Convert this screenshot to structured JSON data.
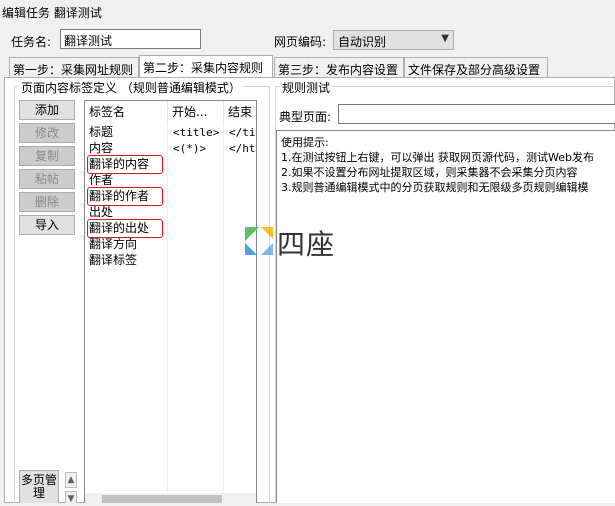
{
  "window": {
    "title": "编辑任务 翻译测试"
  },
  "task": {
    "name_label": "任务名:",
    "name_value": "翻译测试"
  },
  "encoding": {
    "label": "网页编码:",
    "value": "自动识别"
  },
  "tabs": [
    "第一步：采集网址规则",
    "第二步：采集内容规则",
    "第三步：发布内容设置",
    "文件保存及部分高级设置"
  ],
  "left_panel": {
    "legend": "页面内容标签定义 （规则普通编辑模式）",
    "buttons": {
      "add": "添加",
      "edit": "修改",
      "copy": "复制",
      "paste": "粘帖",
      "delete": "删除",
      "import": "导入"
    },
    "manage_button": "多页管理",
    "columns": [
      "标签名",
      "开始...",
      "结束"
    ],
    "rows": [
      {
        "name": "标题",
        "start": "<title>",
        "end": "</ti"
      },
      {
        "name": "内容",
        "start": "<(*)>",
        "end": "</ht"
      },
      {
        "name": "翻译的内容",
        "start": "",
        "end": ""
      },
      {
        "name": "作者",
        "start": "",
        "end": ""
      },
      {
        "name": "翻译的作者",
        "start": "",
        "end": ""
      },
      {
        "name": "出处",
        "start": "",
        "end": ""
      },
      {
        "name": "翻译的出处",
        "start": "",
        "end": ""
      },
      {
        "name": "翻译方向",
        "start": "",
        "end": ""
      },
      {
        "name": "翻译标签",
        "start": "",
        "end": ""
      }
    ]
  },
  "right_panel": {
    "legend": "规则测试",
    "typical_page_label": "典型页面:",
    "typical_page_value": "",
    "tips": [
      "使用提示:",
      "1.在测试按钮上右键，可以弹出 获取网页源代码，测试Web发布",
      "2.如果不设置分布网址提取区域，则采集器不会采集分页内容",
      "3.规则普通编辑模式中的分页获取规则和无限级多页规则编辑模"
    ]
  },
  "watermark": {
    "text": "四座"
  },
  "colors": {
    "highlight": "#e0161d",
    "watermark_green": "#43b649",
    "watermark_blue": "#2f8ce0",
    "watermark_yellow": "#f5b400"
  }
}
